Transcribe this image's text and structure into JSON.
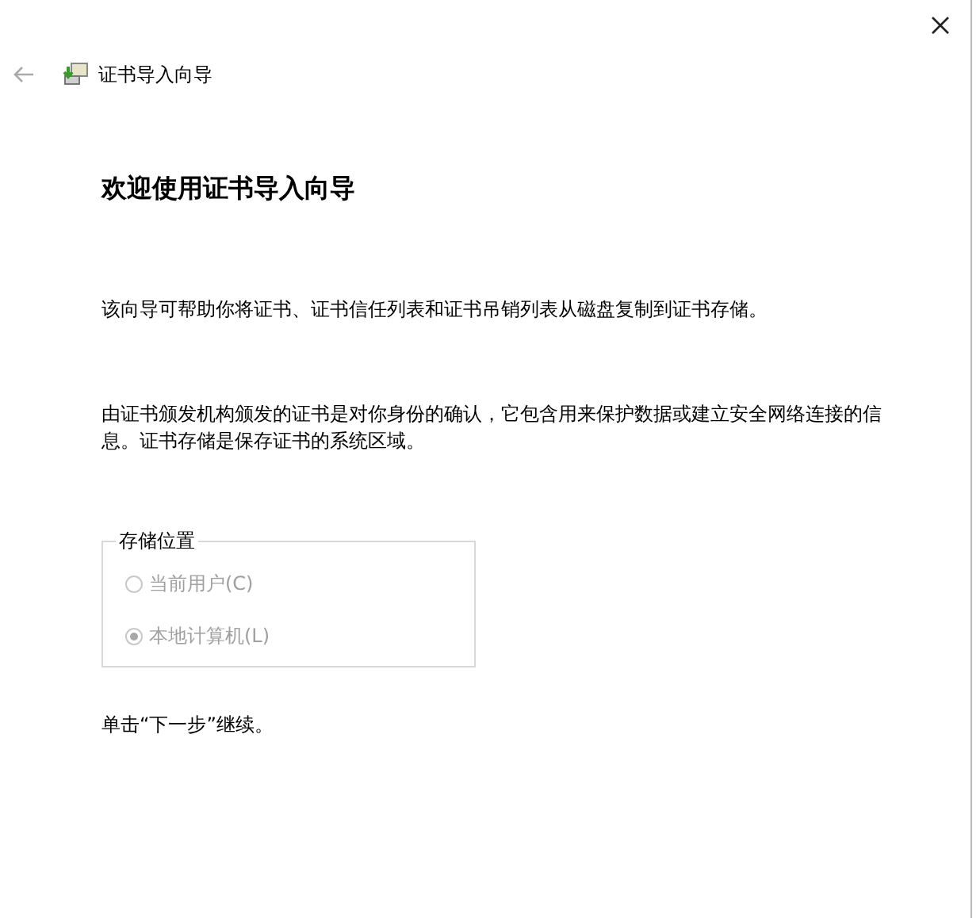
{
  "window": {
    "title": "证书导入向导"
  },
  "heading": "欢迎使用证书导入向导",
  "paragraphs": [
    "该向导可帮助你将证书、证书信任列表和证书吊销列表从磁盘复制到证书存储。",
    "由证书颁发机构颁发的证书是对你身份的确认，它包含用来保护数据或建立安全网络连接的信息。证书存储是保存证书的系统区域。"
  ],
  "store_location": {
    "label": "存储位置",
    "options": [
      {
        "label": "当前用户(C)",
        "selected": false,
        "disabled": true
      },
      {
        "label": "本地计算机(L)",
        "selected": true,
        "disabled": true
      }
    ]
  },
  "footer": "单击“下一步”继续。"
}
